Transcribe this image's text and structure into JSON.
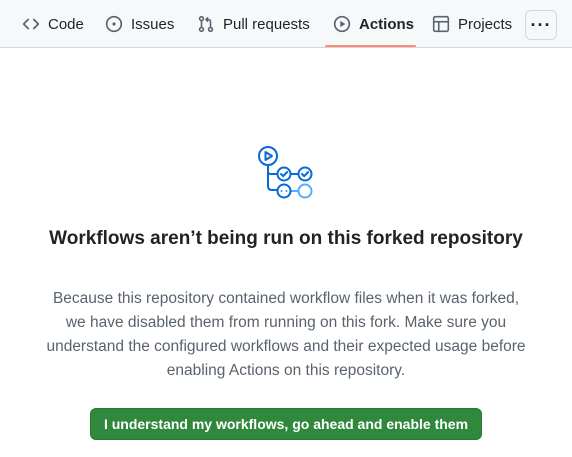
{
  "tabs": [
    {
      "label": "Code",
      "icon": "code-icon"
    },
    {
      "label": "Issues",
      "icon": "issue-opened-icon"
    },
    {
      "label": "Pull requests",
      "icon": "git-pull-request-icon"
    },
    {
      "label": "Actions",
      "icon": "play-icon",
      "active": true
    },
    {
      "label": "Projects",
      "icon": "table-icon"
    }
  ],
  "more_button": {
    "label": "···",
    "icon": "kebab-horizontal-icon"
  },
  "blankslate": {
    "icon": "workflow-illustration",
    "title": "Workflows aren’t being run on this forked repository",
    "description": "Because this repository contained workflow files when it was forked, we have disabled them from running on this fork. Make sure you understand the configured workflows and their expected usage before enabling Actions on this repository.",
    "button_label": "I understand my workflows, go ahead and enable them"
  },
  "colors": {
    "accent_blue": "#0969da",
    "accent_blue_light": "#54aeff",
    "active_tab_underline": "#fd8c73",
    "primary_button": "#2f883b",
    "nav_background": "#f6f8fa"
  }
}
